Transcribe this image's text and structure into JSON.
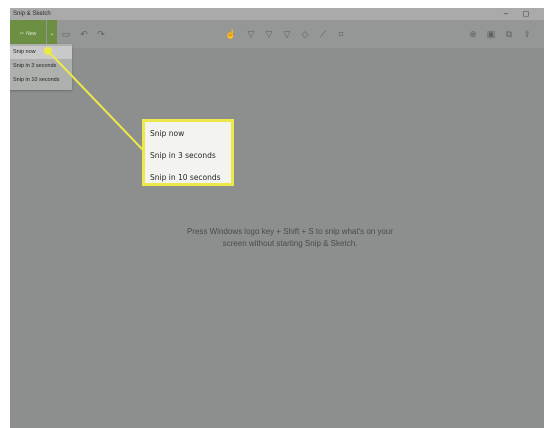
{
  "window": {
    "title": "Snip & Sketch"
  },
  "titlebar": {
    "minimize_glyph": "–",
    "maximize_glyph": "◻"
  },
  "toolbar": {
    "new_label": "New",
    "new_icon": "scissors-icon",
    "caret_glyph": "⌄",
    "icons": [
      "open-icon",
      "undo-icon",
      "redo-icon",
      "touch-writing-icon",
      "ballpoint-pen-icon",
      "pencil-icon",
      "highlighter-icon",
      "eraser-icon",
      "ruler-icon",
      "crop-icon",
      "zoom-icon",
      "save-icon",
      "copy-icon",
      "share-icon"
    ]
  },
  "dropdown": {
    "items": [
      "Snip now",
      "Snip in 3 seconds",
      "Snip in 10 seconds"
    ]
  },
  "callout": {
    "items": [
      "Snip now",
      "Snip in 3 seconds",
      "Snip in 10 seconds"
    ],
    "border_color": "#ece84a"
  },
  "canvas": {
    "hint_line1": "Press Windows logo key + Shift + S to snip what's on your",
    "hint_line2": "screen without starting Snip & Sketch."
  },
  "colors": {
    "accent_green": "#6d8f43",
    "highlight_yellow": "#ece84a",
    "canvas_gray": "#8d8f8e"
  }
}
